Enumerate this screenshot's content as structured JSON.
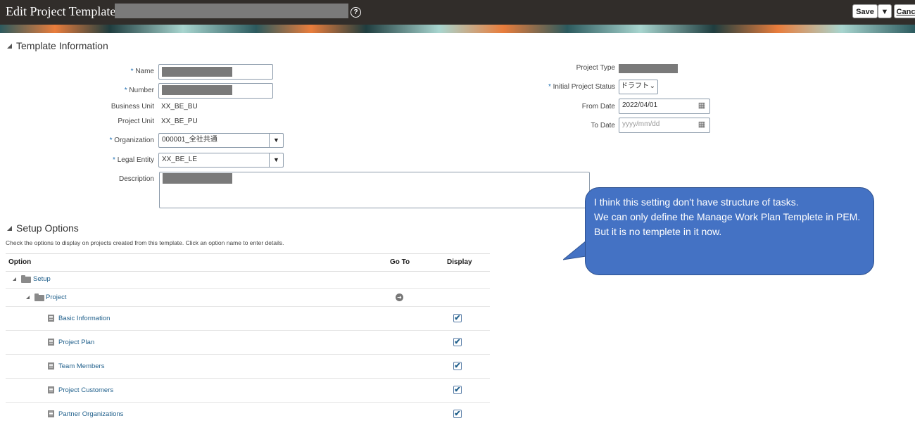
{
  "header": {
    "title": "Edit Project Template:",
    "save_label": "Save",
    "cancel_label": "Canc"
  },
  "template_info": {
    "section_title": "Template Information",
    "name_label": "Name",
    "number_label": "Number",
    "business_unit_label": "Business Unit",
    "business_unit_value": "XX_BE_BU",
    "project_unit_label": "Project Unit",
    "project_unit_value": "XX_BE_PU",
    "organization_label": "Organization",
    "organization_value": "000001_全社共通",
    "legal_entity_label": "Legal Entity",
    "legal_entity_value": "XX_BE_LE",
    "description_label": "Description",
    "project_type_label": "Project Type",
    "initial_status_label": "Initial Project Status",
    "initial_status_value": "ドラフト",
    "from_date_label": "From Date",
    "from_date_value": "2022/04/01",
    "to_date_label": "To Date",
    "to_date_placeholder": "yyyy/mm/dd",
    "required_mark": "*"
  },
  "callout": {
    "line1": "I think this setting don't have structure of tasks.",
    "line2": "We can only define the Manage Work Plan Templete in PEM. But it is no templete in it now."
  },
  "setup_options": {
    "section_title": "Setup Options",
    "description": "Check the options to display on projects created from this template. Click an option name to enter details.",
    "columns": {
      "option": "Option",
      "goto": "Go To",
      "display": "Display"
    },
    "rows": [
      {
        "label": "Setup"
      },
      {
        "label": "Project"
      },
      {
        "label": "Basic Information",
        "checked": true
      },
      {
        "label": "Project Plan",
        "checked": true
      },
      {
        "label": "Team Members",
        "checked": true
      },
      {
        "label": "Project Customers",
        "checked": true
      },
      {
        "label": "Partner Organizations",
        "checked": true
      }
    ]
  },
  "icons": {
    "help": "help-icon",
    "calendar": "calendar-icon",
    "dropdown": "chevron-down-icon",
    "goto": "arrow-right-circle-icon",
    "folder": "folder-icon",
    "document": "document-icon",
    "checkmark": "✔"
  }
}
